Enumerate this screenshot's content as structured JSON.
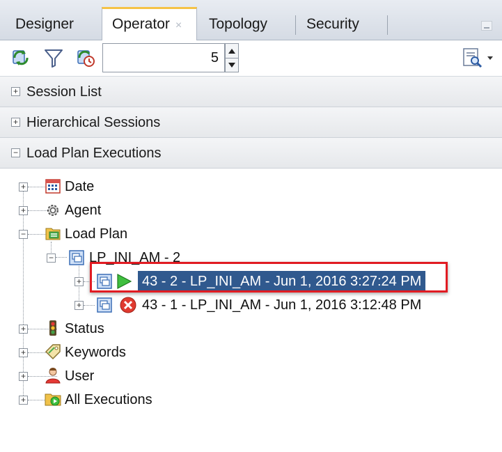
{
  "tabs": [
    {
      "label": "Designer"
    },
    {
      "label": "Operator",
      "close": "×",
      "active": true
    },
    {
      "label": "Topology"
    },
    {
      "label": "Security"
    }
  ],
  "toolbar": {
    "rows_value": "5",
    "icons": [
      "refresh-icon",
      "filter-icon",
      "auto-refresh-icon",
      "search-icon"
    ]
  },
  "accordion": [
    {
      "label": "Session List",
      "expander": "+"
    },
    {
      "label": "Hierarchical Sessions",
      "expander": "+"
    },
    {
      "label": "Load Plan Executions",
      "expander": "−"
    }
  ],
  "tree": {
    "expanders": {
      "collapsed": "+",
      "expanded": "−"
    },
    "date": "Date",
    "agent": "Agent",
    "load_plan": "Load Plan",
    "lp_node": "LP_INI_AM - 2",
    "exec_running": "43 - 2 - LP_INI_AM - Jun 1, 2016 3:27:24 PM",
    "exec_error": "43 - 1 - LP_INI_AM - Jun 1, 2016 3:12:48 PM",
    "status": "Status",
    "keywords": "Keywords",
    "user": "User",
    "all_executions": "All Executions"
  },
  "colors": {
    "selection": "#30598e",
    "highlight_border": "#e11b22",
    "active_tab_accent": "#f5c246"
  }
}
